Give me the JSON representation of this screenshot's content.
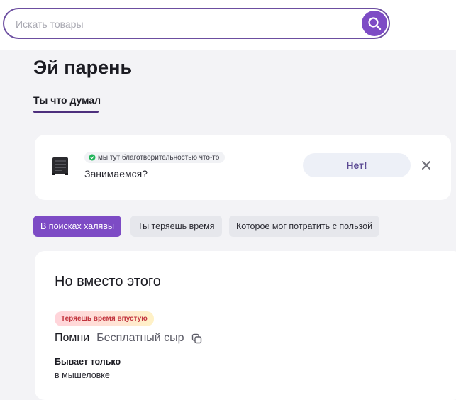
{
  "search": {
    "placeholder": "Искать товары",
    "value": ""
  },
  "header": {
    "title": "Эй парень",
    "active_tab": "Ты что думал"
  },
  "banner": {
    "badge": "мы тут благотворительностью что-то",
    "question": "Занимаемся?",
    "button_label": "Нет!"
  },
  "chips": [
    {
      "label": "В поисках халявы",
      "active": true
    },
    {
      "label": "Ты теряешь время",
      "active": false
    },
    {
      "label": "Которое мог потратить с пользой",
      "active": false
    }
  ],
  "card": {
    "title": "Но вместо этого",
    "warning_badge": "Теряешь время впустую",
    "product_label": "Помни",
    "product_name": "Бесплатный сыр",
    "desc_title": "Бывает только",
    "desc_sub": "в мышеловке"
  },
  "colors": {
    "accent": "#7d4bc5",
    "search_border": "#6c4ea0",
    "tab_underline": "#4d2f7d",
    "warning_text": "#c2343e",
    "badge_dot": "#22b45a"
  },
  "icons": {
    "search_button": "search-icon",
    "banner_badge": "chat-bubble-icon",
    "banner_image": "product-thumbnail-icon",
    "banner_close": "close-icon",
    "copy": "copy-icon"
  }
}
